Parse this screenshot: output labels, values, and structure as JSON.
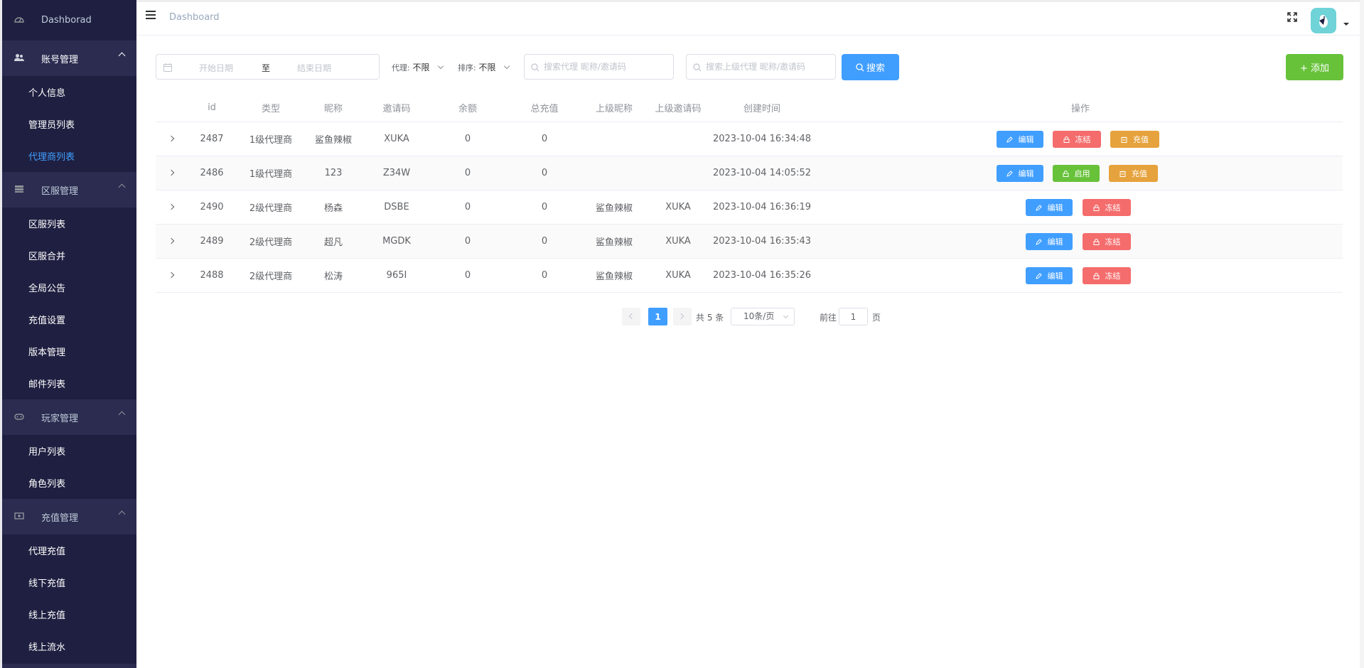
{
  "sidebar": {
    "top_item": {
      "label": "Dashborad",
      "icon": "dashboard-icon"
    },
    "groups": [
      {
        "label": "账号管理",
        "icon": "users-icon",
        "items": [
          "个人信息",
          "管理员列表",
          "代理商列表"
        ]
      },
      {
        "label": "区服管理",
        "icon": "server-icon",
        "items": [
          "区服列表",
          "区服合并",
          "全局公告",
          "充值设置",
          "版本管理",
          "邮件列表"
        ]
      },
      {
        "label": "玩家管理",
        "icon": "gamepad-icon",
        "items": [
          "用户列表",
          "角色列表"
        ]
      },
      {
        "label": "充值管理",
        "icon": "money-icon",
        "items": [
          "代理充值",
          "线下充值",
          "线上充值",
          "线上流水"
        ]
      }
    ],
    "current_item": "代理商列表"
  },
  "header": {
    "breadcrumb": "Dashboard",
    "icons": [
      "hamburger-icon",
      "fullscreen-icon",
      "avatar"
    ]
  },
  "filters": {
    "date_start_placeholder": "开始日期",
    "date_separator": "至",
    "date_end_placeholder": "结束日期",
    "agent_label": "代理:",
    "agent_value": "不限",
    "sort_label": "排序:",
    "sort_value": "不限",
    "search_agent_placeholder": "搜索代理 昵称/邀请码",
    "search_parent_placeholder": "搜索上级代理 昵称/邀请码",
    "search_button": "搜索",
    "add_button": "+ 添加"
  },
  "table": {
    "headers": [
      "id",
      "类型",
      "昵称",
      "邀请码",
      "余额",
      "总充值",
      "上级昵称",
      "上级邀请码",
      "创建时间",
      "操作"
    ],
    "rows": [
      {
        "id": "2487",
        "type": "1级代理商",
        "nickname": "鲨鱼辣椒",
        "code": "XUKA",
        "balance": "0",
        "total": "0",
        "parent_nick": "",
        "parent_code": "",
        "created": "2023-10-04 16:34:48",
        "actions": [
          "编辑",
          "冻结",
          "充值"
        ]
      },
      {
        "id": "2486",
        "type": "1级代理商",
        "nickname": "123",
        "code": "Z34W",
        "balance": "0",
        "total": "0",
        "parent_nick": "",
        "parent_code": "",
        "created": "2023-10-04 14:05:52",
        "actions": [
          "编辑",
          "启用",
          "充值"
        ]
      },
      {
        "id": "2490",
        "type": "2级代理商",
        "nickname": "杨森",
        "code": "DSBE",
        "balance": "0",
        "total": "0",
        "parent_nick": "鲨鱼辣椒",
        "parent_code": "XUKA",
        "created": "2023-10-04 16:36:19",
        "actions": [
          "编辑",
          "冻结"
        ]
      },
      {
        "id": "2489",
        "type": "2级代理商",
        "nickname": "超凡",
        "code": "MGDK",
        "balance": "0",
        "total": "0",
        "parent_nick": "鲨鱼辣椒",
        "parent_code": "XUKA",
        "created": "2023-10-04 16:35:43",
        "actions": [
          "编辑",
          "冻结"
        ]
      },
      {
        "id": "2488",
        "type": "2级代理商",
        "nickname": "松涛",
        "code": "965I",
        "balance": "0",
        "total": "0",
        "parent_nick": "鲨鱼辣椒",
        "parent_code": "XUKA",
        "created": "2023-10-04 16:35:26",
        "actions": [
          "编辑",
          "冻结"
        ]
      }
    ]
  },
  "pagination": {
    "current_page": "1",
    "total_text": "共 5 条",
    "page_size": "10条/页",
    "goto_label": "前往",
    "goto_value": "1",
    "goto_unit": "页"
  },
  "colors": {
    "sidebar_bg": "#1f2041",
    "sidebar_group_bg": "#2b2c50",
    "primary": "#409eff",
    "success": "#67c23a",
    "danger": "#f56c6c",
    "warning": "#e6a23c"
  }
}
